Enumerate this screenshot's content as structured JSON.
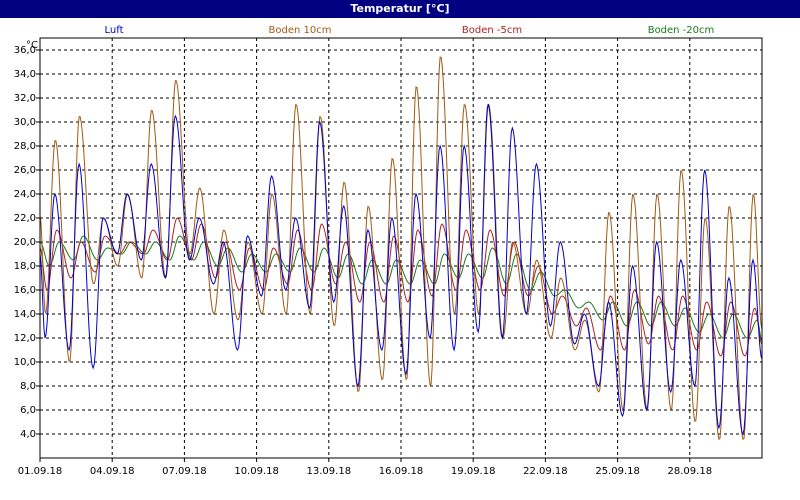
{
  "window": {
    "title": "Temperatur [°C]"
  },
  "chart_data": {
    "type": "line",
    "title": "Temperatur [°C]",
    "ylabel": "°C",
    "xlabel": "",
    "ylim": [
      2.0,
      37.0
    ],
    "yticks": [
      4.0,
      6.0,
      8.0,
      10.0,
      12.0,
      14.0,
      16.0,
      18.0,
      20.0,
      22.0,
      24.0,
      26.0,
      28.0,
      30.0,
      32.0,
      34.0,
      36.0
    ],
    "ytick_labels": [
      "4,0",
      "6,0",
      "8,0",
      "10,0",
      "12,0",
      "14,0",
      "16,0",
      "18,0",
      "20,0",
      "22,0",
      "24,0",
      "26,0",
      "28,0",
      "30,0",
      "32,0",
      "34,0",
      "36,0"
    ],
    "xlim": [
      "01.09.18",
      "01.10.18"
    ],
    "xticks": [
      "01.09.18",
      "04.09.18",
      "07.09.18",
      "10.09.18",
      "13.09.18",
      "16.09.18",
      "19.09.18",
      "22.09.18",
      "25.09.18",
      "28.09.18"
    ],
    "grid": true,
    "legend_position": "top",
    "colors": {
      "title_bar": "#000080",
      "grid": "#000000"
    },
    "series": [
      {
        "name": "Luft",
        "color": "#0000cc",
        "daily_max": [
          24.0,
          26.5,
          22.0,
          24.0,
          26.5,
          30.5,
          22.0,
          20.0,
          20.5,
          25.5,
          22.0,
          30.0,
          23.0,
          21.0,
          22.0,
          24.0,
          28.0,
          28.0,
          31.5,
          29.5,
          26.5,
          20.0,
          14.0,
          15.0,
          18.0,
          20.0,
          18.5,
          26.0,
          17.0,
          18.5
        ],
        "daily_min": [
          12.0,
          11.0,
          9.5,
          19.0,
          18.5,
          17.0,
          18.5,
          16.5,
          11.0,
          15.5,
          16.0,
          14.5,
          15.0,
          8.0,
          11.0,
          9.0,
          12.0,
          11.0,
          12.5,
          12.0,
          14.0,
          13.0,
          11.5,
          8.0,
          5.5,
          6.0,
          7.5,
          8.0,
          4.5,
          4.0
        ]
      },
      {
        "name": "Boden 10cm",
        "color": "#a05a14",
        "daily_max": [
          28.5,
          30.5,
          22.0,
          24.0,
          31.0,
          33.5,
          24.5,
          21.0,
          20.0,
          24.0,
          31.5,
          30.5,
          25.0,
          23.0,
          27.0,
          33.0,
          35.5,
          31.5,
          31.5,
          20.0,
          18.5,
          17.0,
          13.5,
          22.5,
          24.0,
          24.0,
          26.0,
          22.0,
          23.0,
          24.0
        ],
        "daily_min": [
          14.0,
          10.0,
          16.5,
          18.0,
          17.0,
          17.0,
          19.0,
          14.0,
          13.5,
          14.0,
          14.0,
          14.0,
          13.0,
          7.5,
          8.5,
          8.5,
          8.0,
          14.0,
          14.0,
          12.0,
          14.0,
          12.0,
          11.0,
          7.5,
          6.0,
          6.0,
          6.0,
          5.0,
          3.5,
          3.5
        ]
      },
      {
        "name": "Boden -5cm",
        "color": "#aa2222",
        "daily_max": [
          21.0,
          20.0,
          20.5,
          20.0,
          21.0,
          22.0,
          21.5,
          20.0,
          19.5,
          19.5,
          21.0,
          21.5,
          20.0,
          20.0,
          20.5,
          21.0,
          21.5,
          21.0,
          21.0,
          20.0,
          18.0,
          15.5,
          14.5,
          15.5,
          16.0,
          15.5,
          15.5,
          15.0,
          15.0,
          14.5
        ],
        "daily_min": [
          16.0,
          17.0,
          17.5,
          19.0,
          19.0,
          18.5,
          18.5,
          17.0,
          16.0,
          16.0,
          16.5,
          16.0,
          16.5,
          15.0,
          15.0,
          15.0,
          15.5,
          16.0,
          16.0,
          15.5,
          15.5,
          14.0,
          13.0,
          11.0,
          11.0,
          11.5,
          11.0,
          11.0,
          10.5,
          10.5
        ]
      },
      {
        "name": "Boden -20cm",
        "color": "#1a7a1a",
        "daily_max": [
          20.0,
          20.5,
          19.5,
          20.0,
          20.0,
          20.5,
          20.0,
          19.5,
          19.0,
          19.0,
          19.5,
          19.5,
          19.0,
          18.5,
          18.5,
          18.5,
          19.0,
          19.0,
          19.5,
          19.0,
          17.5,
          16.0,
          15.0,
          15.0,
          15.0,
          15.0,
          14.5,
          14.0,
          14.0,
          13.5
        ],
        "daily_min": [
          18.0,
          18.5,
          18.5,
          19.0,
          19.0,
          18.5,
          18.5,
          18.0,
          17.5,
          17.5,
          17.5,
          17.5,
          17.0,
          16.5,
          16.5,
          16.5,
          16.5,
          17.0,
          17.0,
          16.5,
          16.0,
          15.5,
          14.5,
          13.5,
          13.0,
          13.0,
          13.0,
          12.5,
          12.0,
          12.0
        ]
      }
    ]
  }
}
